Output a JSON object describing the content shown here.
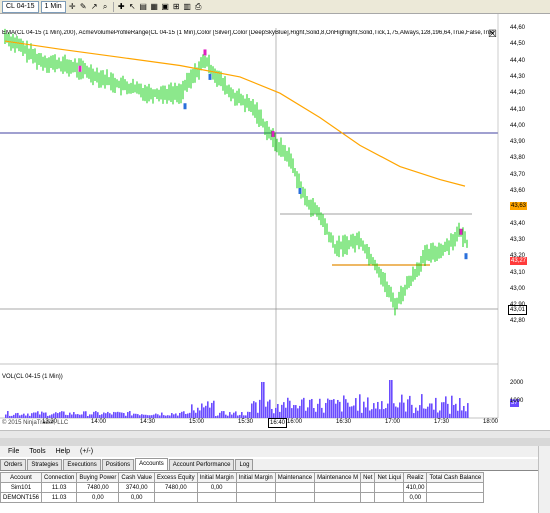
{
  "toolbar": {
    "instrument": "CL 04-15",
    "interval": "1 Min"
  },
  "chart": {
    "indicator_label": "EMA(CL 04-15 (1 Min),200), AcmeVolumeProfileRange(CL 04-15 (1 Min),Color [Silver],Color [DeepSkyBlue],Right,Solid,8,OnHighlight,Solid,Tick,1,75,Always,128,196,64,True,False,True",
    "volume_label": "VOL(CL 04-15 (1 Min))",
    "copyright": "© 2015 NinjaTrader, LLC",
    "price_axis": [
      "44,60",
      "44,50",
      "44,40",
      "44,30",
      "44,20",
      "44,10",
      "44,00",
      "43,90",
      "43,80",
      "43,70",
      "43,60",
      "43,50",
      "43,40",
      "43,30",
      "43,20",
      "43,10",
      "43,00",
      "42,90",
      "42,80"
    ],
    "time_axis": [
      "13:30",
      "14:00",
      "14:30",
      "15:00",
      "15:30",
      "16:00",
      "16:30",
      "17:00",
      "17:30",
      "18:00"
    ],
    "cursor_time": "16:40",
    "volume_axis": [
      "2000",
      "1000"
    ],
    "volume_value": "57",
    "price_tags": {
      "ema": "43,63",
      "last": "43,27",
      "cursor": "43,01"
    },
    "colors": {
      "up": "#00cc00",
      "ema": "#ffa500",
      "hline": "#000080",
      "last_tag": "#ff3b3b",
      "ema_tag": "#ffa500",
      "volume": "#6a4cff"
    }
  },
  "menu": [
    "File",
    "Tools",
    "Help",
    "(+/-)"
  ],
  "tabs": [
    "Orders",
    "Strategies",
    "Executions",
    "Positions",
    "Accounts",
    "Account Performance",
    "Log"
  ],
  "active_tab": "Accounts",
  "accounts": {
    "columns": [
      "Account",
      "Connection",
      "Buying Power",
      "Cash Value",
      "Excess Equity",
      "Initial Margin",
      "Initial Margin",
      "Maintenance",
      "Maintenance M",
      "Net",
      "Net Liqui",
      "Realiz",
      "Total Cash Balance"
    ],
    "rows": [
      [
        "Sim101",
        "11.03",
        "7480,00",
        "3740,00",
        "7480,00",
        "0,00",
        "",
        "",
        "",
        "",
        "",
        "410,00",
        ""
      ],
      [
        "DEMONT156",
        "11.03",
        "0,00",
        "0,00",
        "",
        "",
        "",
        "",
        "",
        "",
        "",
        "0,00",
        ""
      ]
    ]
  }
}
